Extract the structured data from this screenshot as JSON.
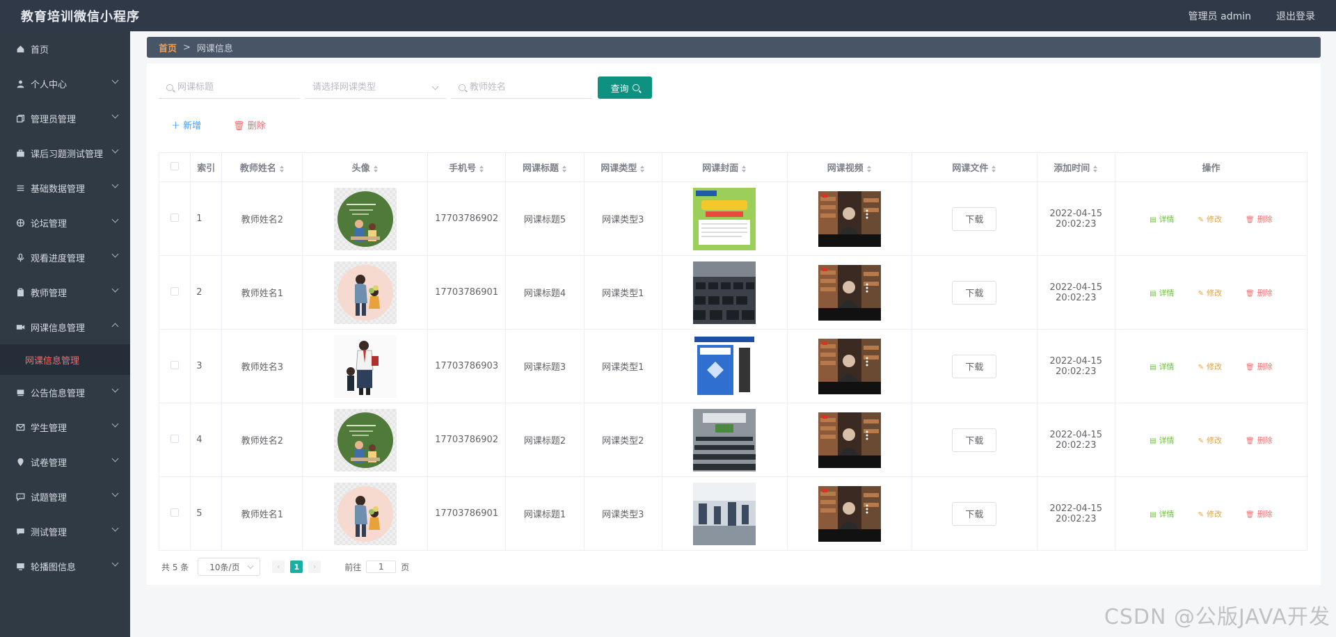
{
  "app": {
    "title": "教育培训微信小程序",
    "user_label": "管理员 admin",
    "logout": "退出登录"
  },
  "sidebar": {
    "items": [
      {
        "label": "首页",
        "icon": "home-icon",
        "expandable": false
      },
      {
        "label": "个人中心",
        "icon": "user-icon",
        "expandable": true
      },
      {
        "label": "管理员管理",
        "icon": "copy-icon",
        "expandable": true
      },
      {
        "label": "课后习题测试管理",
        "icon": "briefcase-icon",
        "expandable": true
      },
      {
        "label": "基础数据管理",
        "icon": "list-icon",
        "expandable": true
      },
      {
        "label": "论坛管理",
        "icon": "compass-icon",
        "expandable": true
      },
      {
        "label": "观看进度管理",
        "icon": "microphone-icon",
        "expandable": true
      },
      {
        "label": "教师管理",
        "icon": "clipboard-icon",
        "expandable": true
      },
      {
        "label": "网课信息管理",
        "icon": "camera-icon",
        "expandable": true,
        "open": true
      },
      {
        "label": "公告信息管理",
        "icon": "reading-icon",
        "expandable": true
      },
      {
        "label": "学生管理",
        "icon": "message-icon",
        "expandable": true
      },
      {
        "label": "试卷管理",
        "icon": "location-icon",
        "expandable": true
      },
      {
        "label": "试题管理",
        "icon": "chat-icon",
        "expandable": true
      },
      {
        "label": "测试管理",
        "icon": "comment-icon",
        "expandable": true
      },
      {
        "label": "轮播图信息",
        "icon": "monitor-icon",
        "expandable": true
      }
    ],
    "active_sub": "网课信息管理"
  },
  "breadcrumb": {
    "home": "首页",
    "separator": ">",
    "current": "网课信息"
  },
  "search": {
    "title_placeholder": "网课标题",
    "type_placeholder": "请选择网课类型",
    "teacher_placeholder": "教师姓名",
    "query_button": "查询"
  },
  "actions": {
    "add": "新增",
    "delete": "删除"
  },
  "table": {
    "columns": [
      "索引",
      "教师姓名",
      "头像",
      "手机号",
      "网课标题",
      "网课类型",
      "网课封面",
      "网课视频",
      "网课文件",
      "添加时间",
      "操作"
    ],
    "download_label": "下载",
    "op_labels": {
      "detail": "详情",
      "edit": "修改",
      "delete": "删除"
    },
    "rows": [
      {
        "index": "1",
        "teacher": "教师姓名2",
        "avatar": "teacher-board",
        "phone": "17703786902",
        "title": "网课标题5",
        "type": "网课类型3",
        "cover": "english-book",
        "time": "2022-04-15 20:02:23"
      },
      {
        "index": "2",
        "teacher": "教师姓名1",
        "avatar": "teacher-student",
        "phone": "17703786901",
        "title": "网课标题4",
        "type": "网课类型1",
        "cover": "computer-lab",
        "time": "2022-04-15 20:02:23"
      },
      {
        "index": "3",
        "teacher": "教师姓名3",
        "avatar": "teacher-standing",
        "phone": "17703786903",
        "title": "网课标题3",
        "type": "网课类型1",
        "cover": "textbook",
        "time": "2022-04-15 20:02:23"
      },
      {
        "index": "4",
        "teacher": "教师姓名2",
        "avatar": "teacher-board",
        "phone": "17703786902",
        "title": "网课标题2",
        "type": "网课类型2",
        "cover": "lecture-hall",
        "time": "2022-04-15 20:02:23"
      },
      {
        "index": "5",
        "teacher": "教师姓名1",
        "avatar": "teacher-student",
        "phone": "17703786901",
        "title": "网课标题1",
        "type": "网课类型3",
        "cover": "classroom",
        "time": "2022-04-15 20:02:23"
      }
    ]
  },
  "pagination": {
    "total": "共 5 条",
    "page_size": "10条/页",
    "current_page": "1",
    "goto_prefix": "前往",
    "goto_value": "1",
    "goto_suffix": "页"
  },
  "watermark": "CSDN @公版JAVA开发",
  "colors": {
    "topbar": "#2f3947",
    "sidebar": "#303a45",
    "query_button": "#0d9181",
    "active_submenu": "#f56c6c",
    "breadcrumb_bar": "#475566",
    "current_page": "#16b0a4"
  }
}
